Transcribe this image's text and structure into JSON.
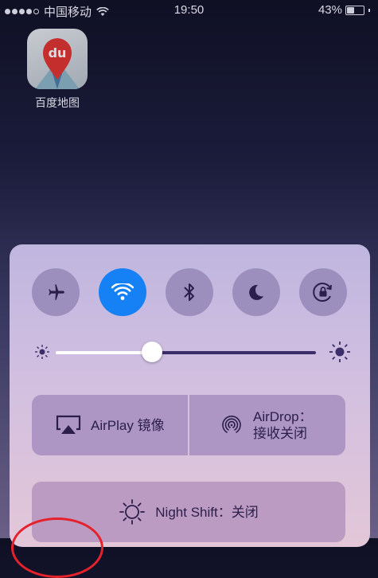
{
  "status_bar": {
    "carrier": "中国移动",
    "time": "19:50",
    "battery": "43%",
    "battery_level": 0.43
  },
  "home_screen": {
    "app": {
      "label": "百度地图",
      "icon_text": "du",
      "icon": "baidu-maps-icon"
    }
  },
  "control_center": {
    "toggles": [
      {
        "name": "airplane-mode",
        "icon": "airplane-icon",
        "active": false
      },
      {
        "name": "wifi",
        "icon": "wifi-icon",
        "active": true
      },
      {
        "name": "bluetooth",
        "icon": "bluetooth-icon",
        "active": false
      },
      {
        "name": "do-not-disturb",
        "icon": "moon-icon",
        "active": false
      },
      {
        "name": "rotation-lock",
        "icon": "rotation-lock-icon",
        "active": false
      }
    ],
    "brightness": {
      "level": 0.37
    },
    "airplay": {
      "label": "AirPlay 镜像",
      "icon": "airplay-icon"
    },
    "airdrop": {
      "label_line1": "AirDrop：",
      "label_line2": "接收关闭",
      "icon": "airdrop-icon"
    },
    "night_shift": {
      "label": "Night Shift：关闭",
      "icon": "night-shift-icon"
    }
  },
  "colors": {
    "accent_active": "#1581f5",
    "annotation_circle": "#e5212c"
  }
}
